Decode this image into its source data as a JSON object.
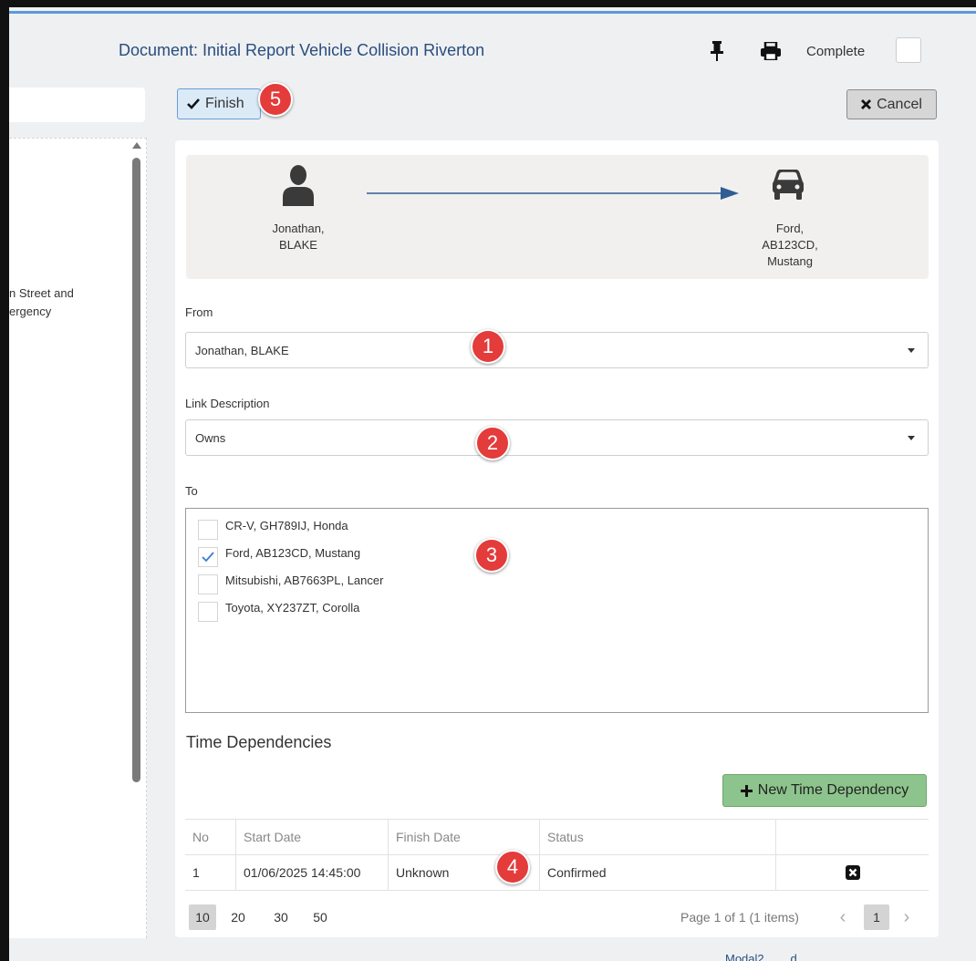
{
  "header": {
    "title": "Document: Initial Report Vehicle Collision Riverton",
    "complete_label": "Complete",
    "complete_checked": false
  },
  "left_panel": {
    "lines": [
      "n Street and",
      "ergency"
    ]
  },
  "toolbar": {
    "finish_label": "Finish",
    "cancel_label": "Cancel"
  },
  "badges": {
    "b1": "1",
    "b2": "2",
    "b3": "3",
    "b4": "4",
    "b5": "5"
  },
  "diagram": {
    "from_lines": [
      "Jonathan,",
      "BLAKE"
    ],
    "to_lines": [
      "Ford,",
      "AB123CD,",
      "Mustang"
    ]
  },
  "form": {
    "from_label": "From",
    "from_value": "Jonathan, BLAKE",
    "link_label": "Link Description",
    "link_value": "Owns",
    "to_label": "To",
    "to_options": [
      {
        "label": "CR-V, GH789IJ, Honda",
        "checked": false
      },
      {
        "label": "Ford, AB123CD, Mustang",
        "checked": true
      },
      {
        "label": "Mitsubishi, AB7663PL, Lancer",
        "checked": false
      },
      {
        "label": "Toyota, XY237ZT, Corolla",
        "checked": false
      }
    ]
  },
  "time_dependencies": {
    "title": "Time Dependencies",
    "new_button": "New Time Dependency",
    "columns": [
      "No",
      "Start Date",
      "Finish Date",
      "Status"
    ],
    "rows": [
      {
        "no": "1",
        "start": "01/06/2025 14:45:00",
        "finish": "Unknown",
        "status": "Confirmed"
      }
    ]
  },
  "pager": {
    "sizes": [
      "10",
      "20",
      "30",
      "50"
    ],
    "active_size": "10",
    "info": "Page 1 of 1 (1 items)",
    "current_page": "1"
  },
  "footer": {
    "text": "Modal2 ... ...d..."
  },
  "colors": {
    "accent": "#2a4d7e",
    "badge": "#e43b3b",
    "finish_bg": "#dbeaf7",
    "new_btn": "#8dc48d"
  }
}
